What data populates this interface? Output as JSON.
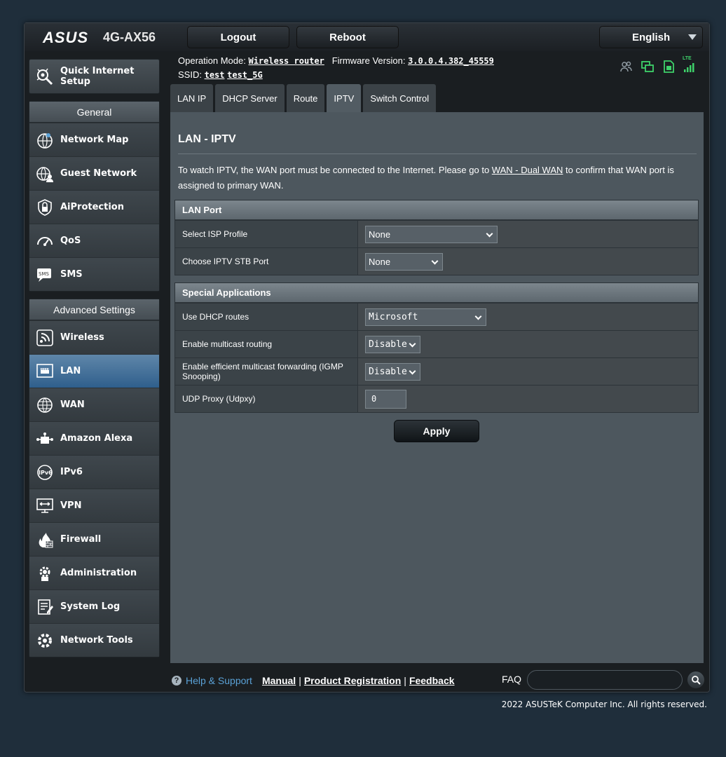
{
  "header": {
    "brand": "ASUS",
    "model": "4G-AX56",
    "logout_label": "Logout",
    "reboot_label": "Reboot",
    "language": "English"
  },
  "info": {
    "op_mode_label": "Operation Mode:",
    "op_mode_value": "Wireless router",
    "fw_label": "Firmware Version:",
    "fw_value": "3.0.0.4.382_45559",
    "ssid_label": "SSID:",
    "ssid_1": "test",
    "ssid_2": "test_5G",
    "status_icons": [
      "clients-icon",
      "network-icon",
      "sim-icon",
      "lte-signal-icon"
    ],
    "lte_label": "LTE"
  },
  "sidebar": {
    "quick_setup": "Quick Internet Setup",
    "general_header": "General",
    "general_items": [
      {
        "label": "Network Map",
        "icon": "network-map-icon"
      },
      {
        "label": "Guest Network",
        "icon": "guest-network-icon"
      },
      {
        "label": "AiProtection",
        "icon": "shield-lock-icon"
      },
      {
        "label": "QoS",
        "icon": "speedometer-icon"
      },
      {
        "label": "SMS",
        "icon": "sms-icon"
      }
    ],
    "advanced_header": "Advanced Settings",
    "advanced_items": [
      {
        "label": "Wireless",
        "icon": "wireless-icon"
      },
      {
        "label": "LAN",
        "icon": "lan-icon"
      },
      {
        "label": "WAN",
        "icon": "globe-icon"
      },
      {
        "label": "Amazon Alexa",
        "icon": "alexa-icon"
      },
      {
        "label": "IPv6",
        "icon": "ipv6-icon"
      },
      {
        "label": "VPN",
        "icon": "vpn-icon"
      },
      {
        "label": "Firewall",
        "icon": "firewall-icon"
      },
      {
        "label": "Administration",
        "icon": "gear-icon"
      },
      {
        "label": "System Log",
        "icon": "system-log-icon"
      },
      {
        "label": "Network Tools",
        "icon": "tools-icon"
      }
    ],
    "active": "LAN"
  },
  "tabs": [
    "LAN IP",
    "DHCP Server",
    "Route",
    "IPTV",
    "Switch Control"
  ],
  "active_tab": "IPTV",
  "main": {
    "title": "LAN - IPTV",
    "desc_before": "To watch IPTV, the WAN port must be connected to the Internet. Please go to ",
    "desc_link": "WAN - Dual WAN",
    "desc_after": " to confirm that WAN port is assigned to primary WAN.",
    "lan_port": {
      "header": "LAN Port",
      "isp_label": "Select ISP Profile",
      "isp_value": "None",
      "stb_label": "Choose IPTV STB Port",
      "stb_value": "None"
    },
    "special": {
      "header": "Special Applications",
      "dhcp_label": "Use DHCP routes",
      "dhcp_value": "Microsoft",
      "multicast_label": "Enable multicast routing",
      "multicast_value": "Disable",
      "igmp_label": "Enable efficient multicast forwarding (IGMP Snooping)",
      "igmp_value": "Disable",
      "udp_label": "UDP Proxy (Udpxy)",
      "udp_value": "0"
    },
    "apply_label": "Apply"
  },
  "footer": {
    "help": "Help & Support",
    "manual": "Manual",
    "registration": "Product Registration",
    "feedback": "Feedback",
    "faq": "FAQ",
    "copyright": "2022 ASUSTeK Computer Inc. All rights reserved."
  }
}
